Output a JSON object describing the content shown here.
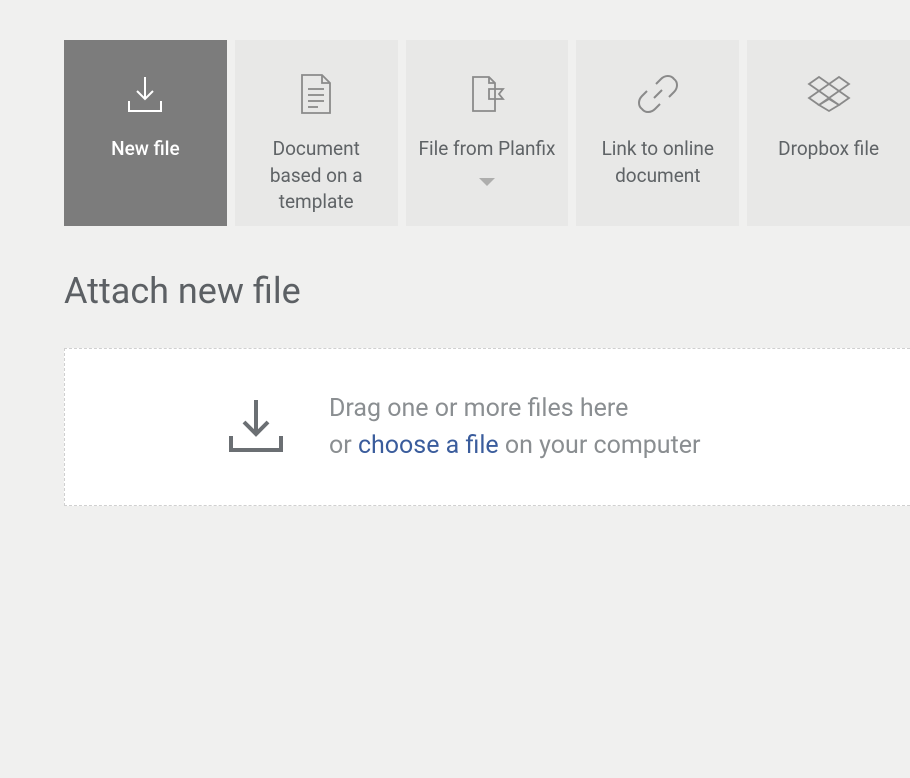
{
  "tabs": [
    {
      "label": "New file",
      "active": true
    },
    {
      "label": "Document based on a template"
    },
    {
      "label": "File from Planfix",
      "hasDropdown": true
    },
    {
      "label": "Link to online document"
    },
    {
      "label": "Dropbox file"
    }
  ],
  "pageTitle": "Attach new file",
  "dropzone": {
    "line1": "Drag one or more files here",
    "line2_prefix": "or ",
    "line2_link": "choose a file",
    "line2_suffix": " on your computer"
  }
}
